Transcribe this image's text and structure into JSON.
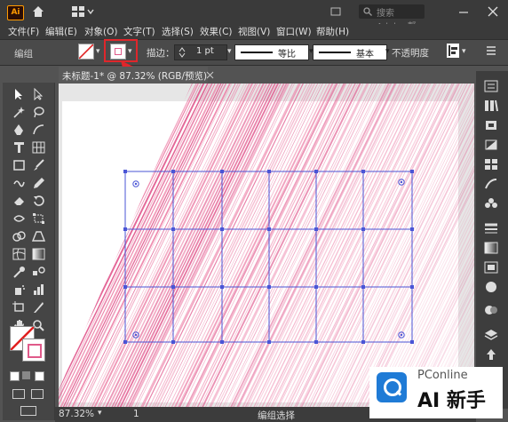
{
  "app": {
    "logo": "Ai",
    "search_placeholder": "搜索 Adobe 帮助"
  },
  "menu": [
    "文件(F)",
    "编辑(E)",
    "对象(O)",
    "文字(T)",
    "选择(S)",
    "效果(C)",
    "视图(V)",
    "窗口(W)",
    "帮助(H)"
  ],
  "control_bar": {
    "selection_label": "编组",
    "stroke_label": "描边：",
    "stroke_weight": "1 pt",
    "profile_label": "等比",
    "brush_label": "基本",
    "opacity_label": "不透明度"
  },
  "document": {
    "tab_title": "未标题-1* @ 87.32% (RGB/预览)"
  },
  "status": {
    "zoom": "87.32%",
    "page": "1",
    "tool": "编组选择"
  },
  "watermark": {
    "brand": "PConline",
    "mark": "AI 新手"
  },
  "colors": {
    "accent_pink": "#e0538a",
    "highlight_red": "#e0262b",
    "grid_blue": "#4a55d6"
  },
  "icons": {
    "topbar": [
      "home-icon",
      "workspace-icon",
      "search-icon",
      "minimize-icon",
      "close-icon"
    ],
    "tools": [
      "selection-tool-icon",
      "direct-selection-tool-icon",
      "magic-wand-icon",
      "lasso-icon",
      "pen-icon",
      "curvature-icon",
      "type-icon",
      "grid-tool-icon",
      "rectangle-icon",
      "brush-icon",
      "shaper-icon",
      "pencil-icon",
      "eraser-icon",
      "scissors-icon",
      "rotate-icon",
      "scale-icon",
      "width-icon",
      "free-transform-icon",
      "shape-builder-icon",
      "perspective-icon",
      "mesh-icon",
      "gradient-icon",
      "eyedropper-icon",
      "blend-icon",
      "symbol-sprayer-icon",
      "graph-icon",
      "artboard-icon",
      "slice-icon",
      "hand-icon",
      "zoom-icon"
    ],
    "panels": [
      "properties-icon",
      "libraries-icon",
      "color-icon",
      "color-guide-icon",
      "swatches-icon",
      "brushes-icon",
      "symbols-icon",
      "stroke-icon",
      "gradient-panel-icon",
      "transparency-icon",
      "appearance-icon",
      "graphic-styles-icon",
      "layers-icon",
      "asset-export-icon",
      "artboards-panel-icon"
    ]
  }
}
